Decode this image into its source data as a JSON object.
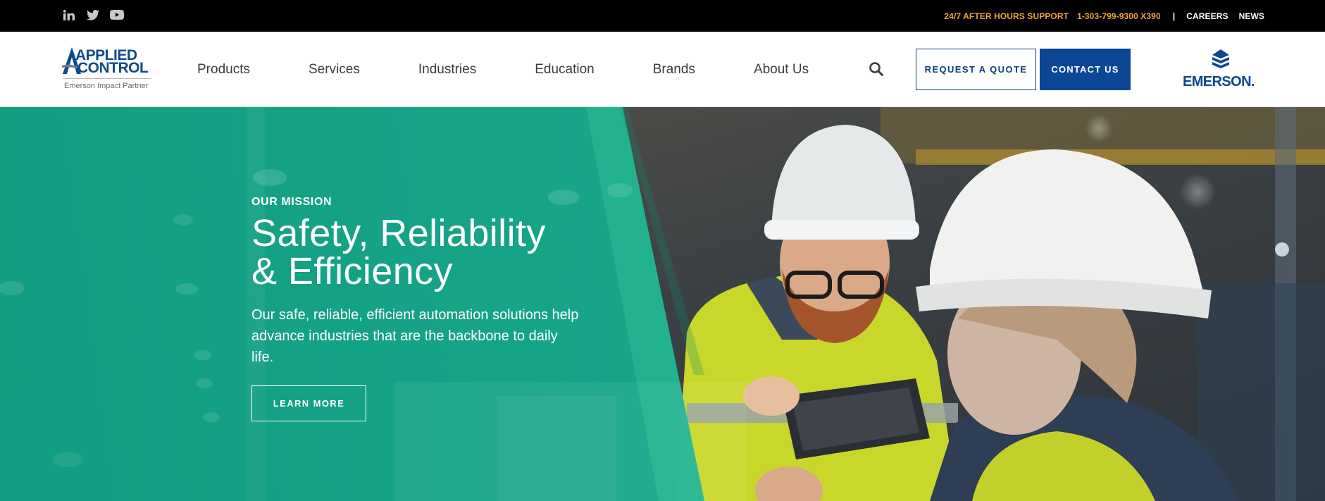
{
  "topbar": {
    "support_label": "24/7 AFTER HOURS SUPPORT",
    "phone": "1-303-799-9300 X390",
    "separator": "|",
    "careers": "CAREERS",
    "news": "NEWS",
    "social": [
      "linkedin-icon",
      "twitter-icon",
      "youtube-icon"
    ]
  },
  "header": {
    "logo": {
      "line1": "APPLIED",
      "line2": "CONTROL",
      "partner": "Emerson Impact Partner"
    },
    "nav": [
      "Products",
      "Services",
      "Industries",
      "Education",
      "Brands",
      "About Us"
    ],
    "search_icon": "search-icon",
    "quote_button": "REQUEST A QUOTE",
    "contact_button": "CONTACT US",
    "partner_logo": "EMERSON."
  },
  "hero": {
    "eyebrow": "OUR MISSION",
    "headline_line1": "Safety, Reliability",
    "headline_line2": "& Efficiency",
    "body": "Our safe, reliable, efficient automation solutions help advance industries that are the backbone to daily life.",
    "cta": "LEARN MORE"
  },
  "colors": {
    "brand_blue": "#0c4796",
    "accent_orange": "#f1a33a",
    "hero_green": "#13a586"
  }
}
